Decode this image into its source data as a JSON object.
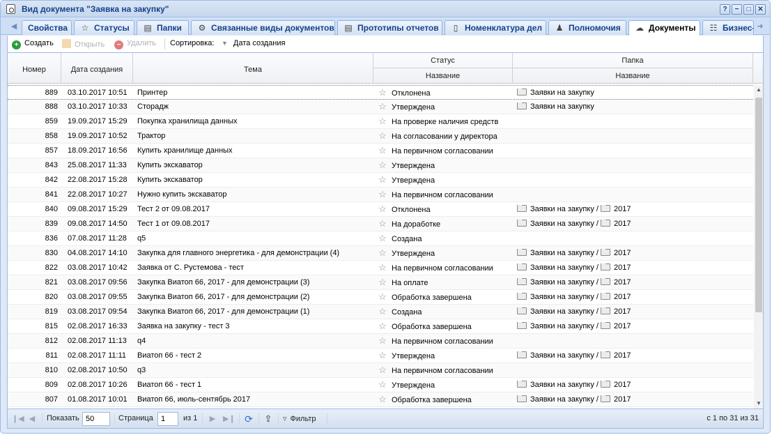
{
  "window": {
    "title": "Вид документа \"Заявка на закупку\""
  },
  "title_buttons": [
    "?",
    "−",
    "□",
    "✕"
  ],
  "tabs": [
    {
      "label": "Свойства",
      "icon": "none"
    },
    {
      "label": "Статусы",
      "icon": "star-icon"
    },
    {
      "label": "Папки",
      "icon": "folder-icon"
    },
    {
      "label": "Связанные виды документов",
      "icon": "gear-document-icon"
    },
    {
      "label": "Прототипы отчетов",
      "icon": "report-icon"
    },
    {
      "label": "Номенклатура дел",
      "icon": "register-icon"
    },
    {
      "label": "Полномочия",
      "icon": "user-icon"
    },
    {
      "label": "Документы",
      "icon": "documents-icon",
      "active": true
    },
    {
      "label": "Бизнес-",
      "icon": "process-icon"
    }
  ],
  "toolbar": {
    "create": "Создать",
    "open": "Открыть",
    "delete": "Удалить",
    "sort_label": "Сортировка:",
    "sort_value": "Дата создания"
  },
  "columns": {
    "number": "Номер",
    "date": "Дата создания",
    "topic": "Тема",
    "status_group": "Статус",
    "status_name": "Название",
    "folder_group": "Папка",
    "folder_name": "Название"
  },
  "rows": [
    {
      "number": "889",
      "date": "03.10.2017 10:51",
      "topic": "Принтер",
      "status": "Отклонена",
      "folder": "Заявки на закупку",
      "subfolder": ""
    },
    {
      "number": "888",
      "date": "03.10.2017 10:33",
      "topic": "Сторадж",
      "status": "Утверждена",
      "folder": "Заявки на закупку",
      "subfolder": ""
    },
    {
      "number": "859",
      "date": "19.09.2017 15:29",
      "topic": "Покупка хранилища данных",
      "status": "На проверке наличия средств",
      "folder": "",
      "subfolder": ""
    },
    {
      "number": "858",
      "date": "19.09.2017 10:52",
      "topic": "Трактор",
      "status": "На согласовании у директора",
      "folder": "",
      "subfolder": ""
    },
    {
      "number": "857",
      "date": "18.09.2017 16:56",
      "topic": "Купить хранилище данных",
      "status": "На первичном согласовании",
      "folder": "",
      "subfolder": ""
    },
    {
      "number": "843",
      "date": "25.08.2017 11:33",
      "topic": "Купить экскаватор",
      "status": "Утверждена",
      "folder": "",
      "subfolder": ""
    },
    {
      "number": "842",
      "date": "22.08.2017 15:28",
      "topic": "Купить экскаватор",
      "status": "Утверждена",
      "folder": "",
      "subfolder": ""
    },
    {
      "number": "841",
      "date": "22.08.2017 10:27",
      "topic": "Нужно купить экскаватор",
      "status": "На первичном согласовании",
      "folder": "",
      "subfolder": ""
    },
    {
      "number": "840",
      "date": "09.08.2017 15:29",
      "topic": "Тест 2 от 09.08.2017",
      "status": "Отклонена",
      "folder": "Заявки на закупку",
      "subfolder": "2017"
    },
    {
      "number": "839",
      "date": "09.08.2017 14:50",
      "topic": "Тест 1 от 09.08.2017",
      "status": "На доработке",
      "folder": "Заявки на закупку",
      "subfolder": "2017"
    },
    {
      "number": "836",
      "date": "07.08.2017 11:28",
      "topic": "q5",
      "status": "Создана",
      "folder": "",
      "subfolder": ""
    },
    {
      "number": "830",
      "date": "04.08.2017 14:10",
      "topic": "Закупка для главного энергетика - для демонстрации (4)",
      "status": "Утверждена",
      "folder": "Заявки на закупку",
      "subfolder": "2017"
    },
    {
      "number": "822",
      "date": "03.08.2017 10:42",
      "topic": "Заявка от С. Рустемова - тест",
      "status": "На первичном согласовании",
      "folder": "Заявки на закупку",
      "subfolder": "2017"
    },
    {
      "number": "821",
      "date": "03.08.2017 09:56",
      "topic": "Закупка Виатоп 66, 2017 - для демонстрации (3)",
      "status": "На оплате",
      "folder": "Заявки на закупку",
      "subfolder": "2017"
    },
    {
      "number": "820",
      "date": "03.08.2017 09:55",
      "topic": "Закупка Виатоп 66, 2017 - для демонстрации (2)",
      "status": "Обработка завершена",
      "folder": "Заявки на закупку",
      "subfolder": "2017"
    },
    {
      "number": "819",
      "date": "03.08.2017 09:54",
      "topic": "Закупка Виатоп 66, 2017 - для демонстрации (1)",
      "status": "Создана",
      "folder": "Заявки на закупку",
      "subfolder": "2017"
    },
    {
      "number": "815",
      "date": "02.08.2017 16:33",
      "topic": "Заявка на закупку - тест 3",
      "status": "Обработка завершена",
      "folder": "Заявки на закупку",
      "subfolder": "2017"
    },
    {
      "number": "812",
      "date": "02.08.2017 11:13",
      "topic": "q4",
      "status": "На первичном согласовании",
      "folder": "",
      "subfolder": ""
    },
    {
      "number": "811",
      "date": "02.08.2017 11:11",
      "topic": "Виатоп 66 - тест 2",
      "status": "Утверждена",
      "folder": "Заявки на закупку",
      "subfolder": "2017"
    },
    {
      "number": "810",
      "date": "02.08.2017 10:50",
      "topic": "q3",
      "status": "На первичном согласовании",
      "folder": "",
      "subfolder": ""
    },
    {
      "number": "809",
      "date": "02.08.2017 10:26",
      "topic": "Виатоп 66 - тест 1",
      "status": "Утверждена",
      "folder": "Заявки на закупку",
      "subfolder": "2017"
    },
    {
      "number": "807",
      "date": "01.08.2017 10:01",
      "topic": "Виатоп 66, июль-сентябрь 2017",
      "status": "Обработка завершена",
      "folder": "Заявки на закупку",
      "subfolder": "2017"
    }
  ],
  "pager": {
    "show_label": "Показать",
    "page_size": "50",
    "page_label": "Страница",
    "page": "1",
    "of_label": "из 1",
    "filter_label": "Фильтр",
    "summary": "с 1 по 31 из 31"
  },
  "colors": {
    "accent": "#15428b",
    "border": "#99bbe8",
    "create_icon": "#2e9b3b",
    "delete_icon": "#e07b7b"
  }
}
